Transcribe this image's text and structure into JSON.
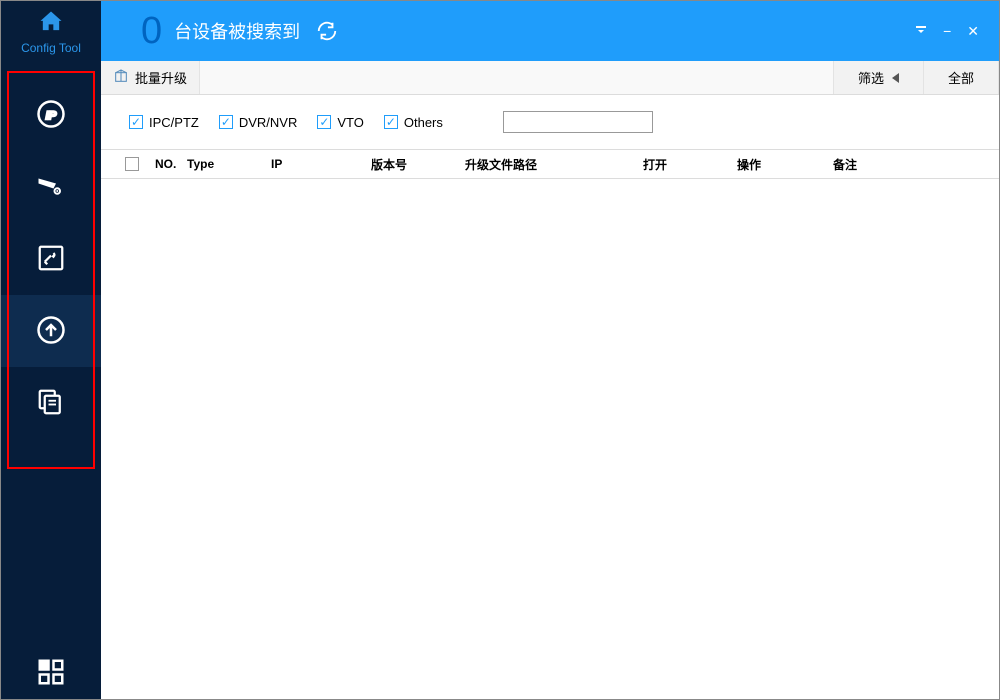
{
  "brand": {
    "name": "Config Tool"
  },
  "header": {
    "count": "0",
    "title": "台设备被搜索到"
  },
  "toolbar": {
    "batch_upgrade": "批量升级",
    "filter": "筛选",
    "all": "全部"
  },
  "filters": {
    "ipcptz": "IPC/PTZ",
    "dvrnvr": "DVR/NVR",
    "vto": "VTO",
    "others": "Others",
    "search_value": ""
  },
  "table": {
    "headers": {
      "no": "NO.",
      "type": "Type",
      "ip": "IP",
      "version": "版本号",
      "upgrade_path": "升级文件路径",
      "open": "打开",
      "operation": "操作",
      "note": "备注"
    },
    "rows": []
  }
}
